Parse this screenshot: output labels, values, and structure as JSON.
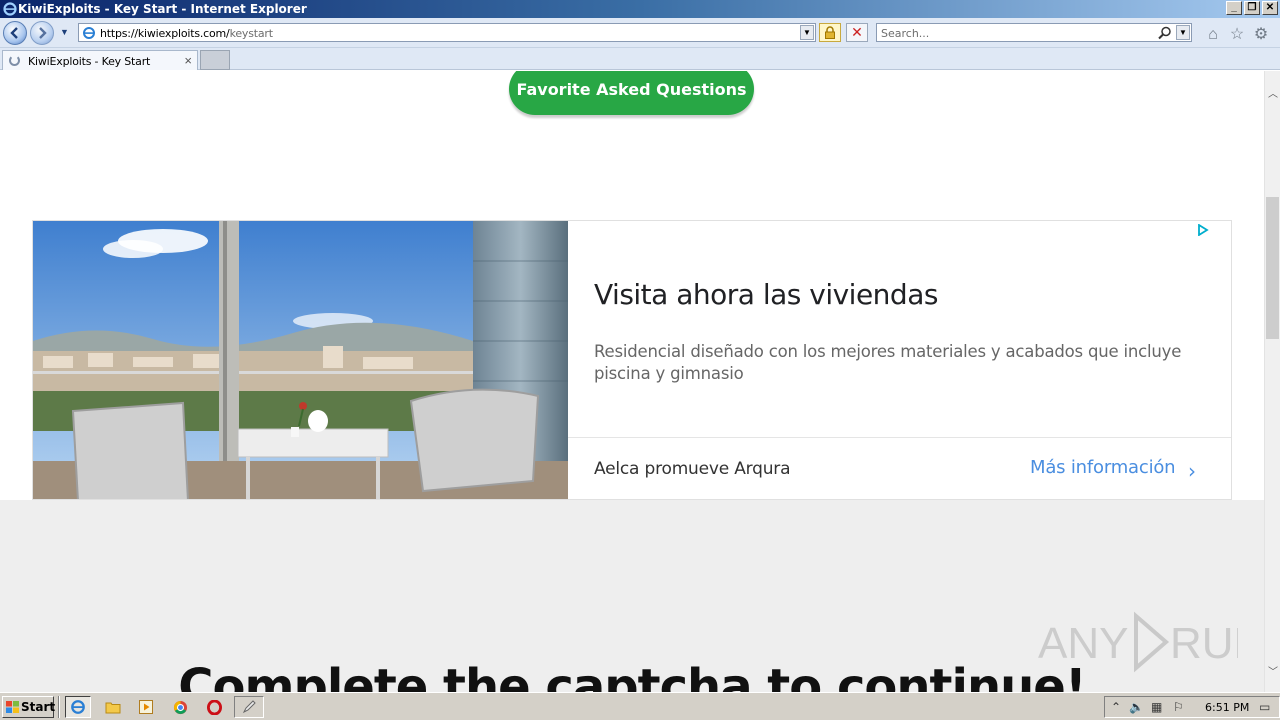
{
  "window": {
    "title": "KiwiExploits - Key Start - Internet Explorer",
    "controls": [
      "_",
      "❐",
      "✕"
    ]
  },
  "navbar": {
    "url_host": "https://kiwiexploits.com/",
    "url_path": "keystart",
    "search_placeholder": "Search..."
  },
  "tab": {
    "label": "KiwiExploits - Key Start"
  },
  "page": {
    "faq_button": "Favorite Asked Questions",
    "captcha_heading": "Complete the captcha to continue!"
  },
  "ad": {
    "headline": "Visita ahora las viviendas",
    "description": "Residencial diseñado con los mejores materiales y acabados que incluye piscina y gimnasio",
    "advertiser": "Aelca promueve Arqura",
    "cta": "Más información",
    "cta_color": "#4a8ee0"
  },
  "watermark": {
    "text": "ANY RUN"
  },
  "taskbar": {
    "start_label": "Start",
    "clock": "6:51 PM"
  },
  "colors": {
    "faq_button_bg": "#28a745",
    "gray_section_bg": "#eeeeee"
  }
}
